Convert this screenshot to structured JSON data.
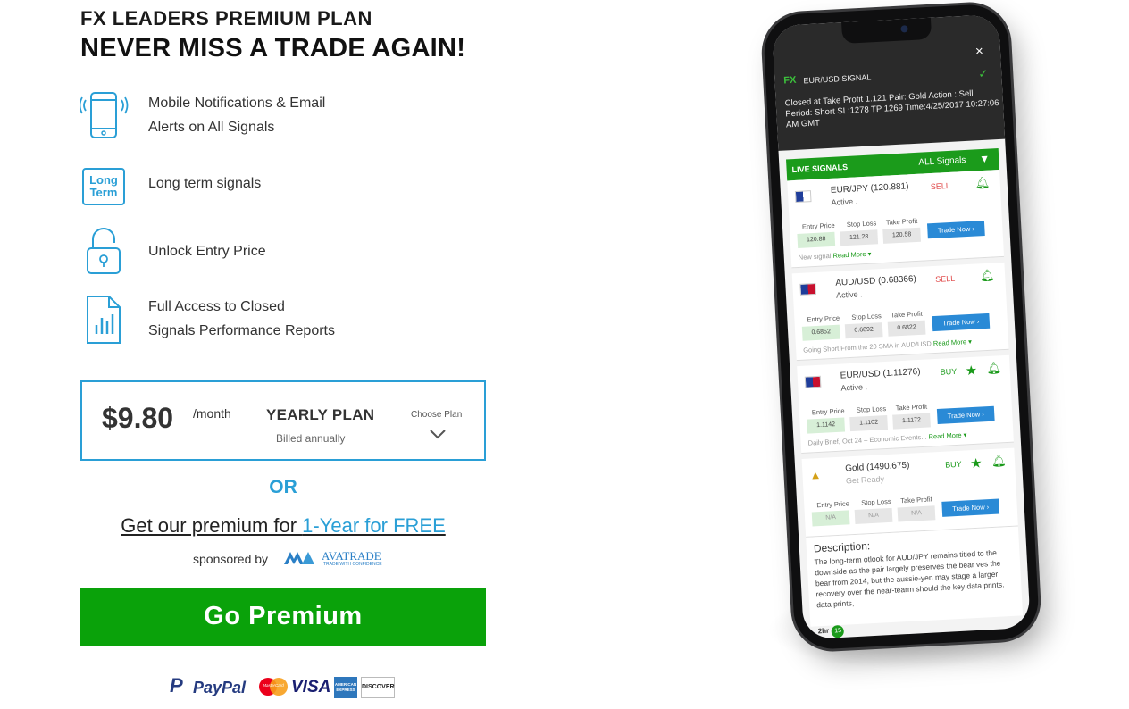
{
  "header": {
    "plan_title": "FX LEADERS PREMIUM PLAN",
    "plan_subtitle": "NEVER MISS A TRADE AGAIN!"
  },
  "features": [
    {
      "icon": "mobile-phone-icon",
      "line1": "Mobile Notifications & Email",
      "line2": "Alerts on All Signals"
    },
    {
      "icon": "long-term-icon",
      "icon_text_1": "Long",
      "icon_text_2": "Term",
      "line1": "Long term signals",
      "line2": ""
    },
    {
      "icon": "unlock-icon",
      "line1": "Unlock Entry Price",
      "line2": ""
    },
    {
      "icon": "report-icon",
      "line1": "Full Access to Closed",
      "line2": "Signals Performance Reports"
    }
  ],
  "pricing": {
    "amount": "$9.80",
    "period": "/month",
    "plan_name": "YEARLY PLAN",
    "billing": "Billed annually",
    "choose_label": "Choose Plan"
  },
  "promo": {
    "or_text": "OR",
    "free_prefix": "Get our premium for ",
    "free_highlight": "1-Year for FREE",
    "sponsored_by": "sponsored by",
    "sponsor_name": "AVATRADE",
    "sponsor_tagline": "TRADE WITH CONFIDENCE"
  },
  "cta": {
    "label": "Go Premium",
    "color": "#0aa20a"
  },
  "payments": {
    "paypal": "PayPal",
    "mastercard": "MasterCard",
    "visa": "VISA",
    "amex": "AMERICAN EXPRESS",
    "discover": "DISCOVER"
  },
  "phone": {
    "fx_logo": "FX",
    "signal_title": "EUR/USD SIGNAL",
    "close": "×",
    "check": "✓",
    "message": "Closed at Take Profit 1.121 Pair: Gold Action : Sell Period: Short SL:1278 TP 1269 Time:4/25/2017 10:27:06 AM GMT",
    "live_label": "LIVE SIGNALS",
    "all_signals": "ALL Signals",
    "entry_label": "Entry Price",
    "stop_label": "Stop Loss",
    "take_label": "Take Profit",
    "trade_label": "Trade Now ›",
    "signals": [
      {
        "pair": "EUR/JPY (120.881)",
        "status": "Active .",
        "side": "SELL",
        "entry": "120.88",
        "stop": "121.28",
        "take": "120.58",
        "note": "New signal",
        "more": "Read More ▾"
      },
      {
        "pair": "AUD/USD (0.68366)",
        "status": "Active .",
        "side": "SELL",
        "entry": "0.6852",
        "stop": "0.6892",
        "take": "0.6822",
        "note": "Going Short From the 20 SMA in AUD/USD",
        "more": "Read More ▾"
      },
      {
        "pair": "EUR/USD (1.11276)",
        "status": "Active .",
        "side": "BUY",
        "entry": "1.1142",
        "stop": "1.1102",
        "take": "1.1172",
        "note": "Daily Brief, Oct 24 – Economic Events...",
        "more": "Read More ▾"
      },
      {
        "pair": "Gold (1490.675)",
        "status": "Get Ready",
        "side": "BUY",
        "entry": "N/A",
        "stop": "N/A",
        "take": "N/A",
        "note": "",
        "more": ""
      }
    ],
    "description_title": "Description:",
    "description_body": "The long-term otlook for AUD/JPY remains titled to the downside as the pair largely preserves the bear ves the bear from 2014, but the aussie-yen may stage a larger recovery over the near-tearm should the key data prints. data prints,",
    "time": "2hr",
    "time_badge": "15"
  },
  "colors": {
    "accent_blue": "#2a9fd6",
    "green": "#0aa20a",
    "sell_red": "#e04848"
  }
}
